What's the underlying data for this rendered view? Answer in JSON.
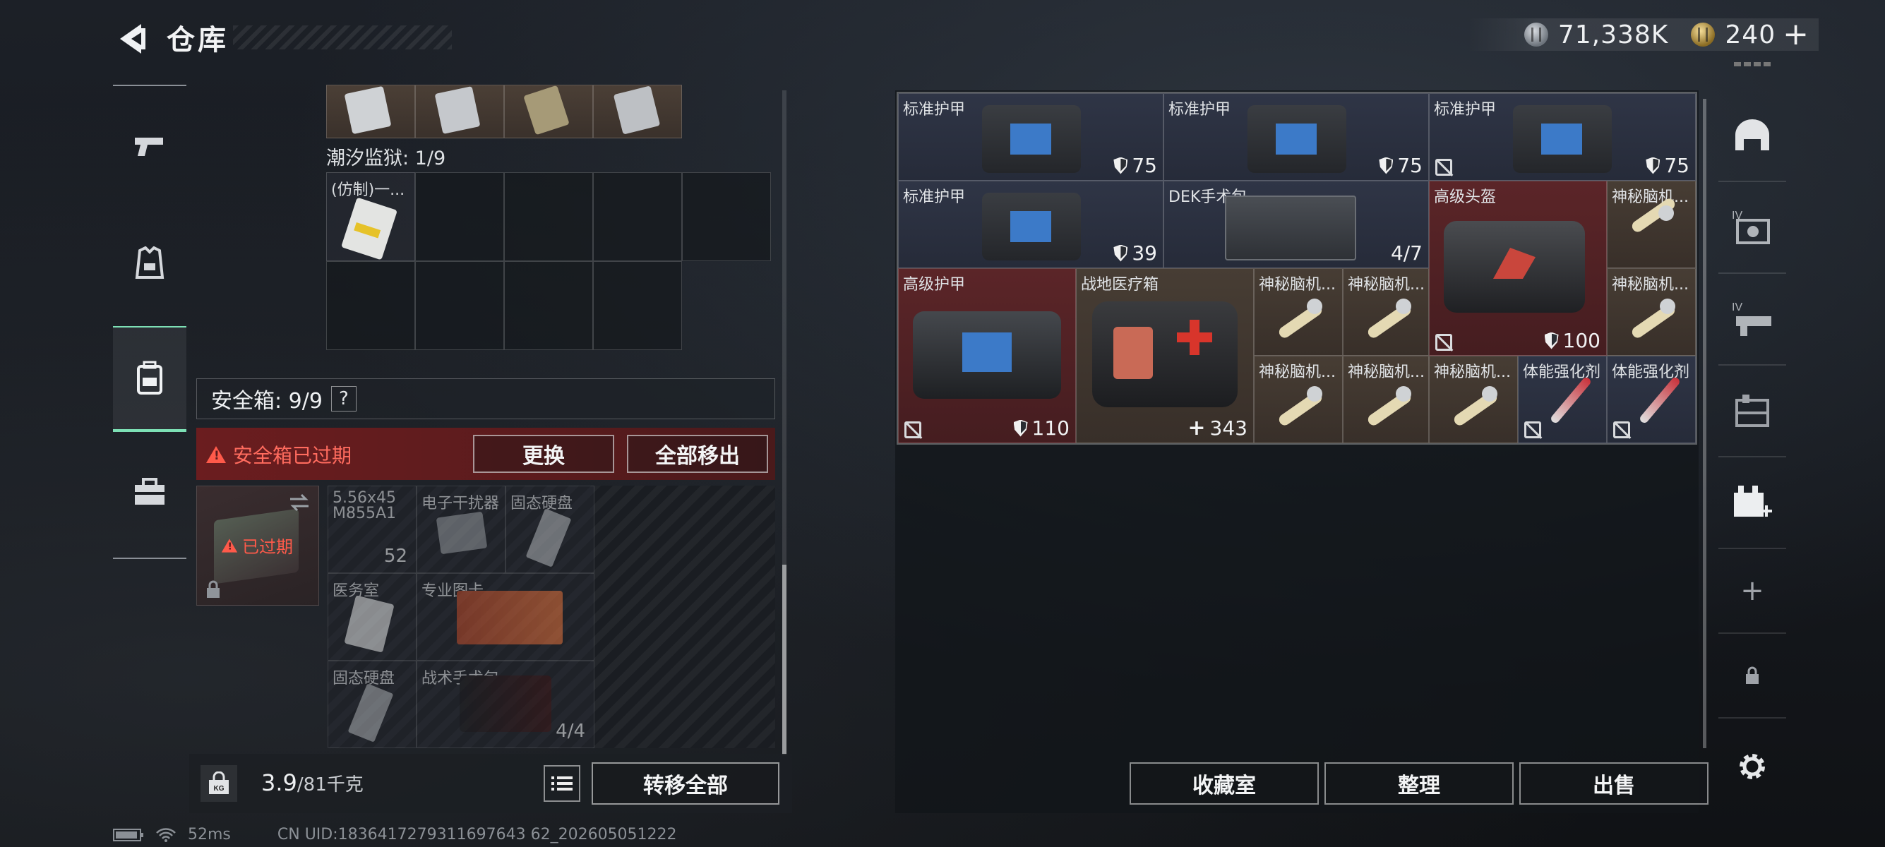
{
  "header": {
    "title": "仓库"
  },
  "currency": {
    "silver": "71,338K",
    "gold": "240",
    "add_symbol": "+"
  },
  "left_nav": [
    {
      "icon": "pistol-icon"
    },
    {
      "icon": "armor-vest-icon"
    },
    {
      "icon": "backpack-icon",
      "active": true
    },
    {
      "icon": "toolbox-icon"
    }
  ],
  "inventory": {
    "prison_label": "潮汐监狱: 1/9",
    "prison_item": "(仿制)一...",
    "safe_box": {
      "title": "安全箱: 9/9",
      "help": "?",
      "expired_msg": "安全箱已过期",
      "replace_label": "更换",
      "move_all_label": "全部移出",
      "thumb_status": "已过期",
      "items": [
        {
          "name": "5.56x45\nM855A1",
          "count": "52"
        },
        {
          "name": "电子干扰器",
          "count": ""
        },
        {
          "name": "固态硬盘",
          "count": ""
        },
        {
          "name": "医务室",
          "count": ""
        },
        {
          "name": "专业图卡",
          "count": ""
        },
        {
          "name": "固态硬盘",
          "count": ""
        },
        {
          "name": "战术手术包",
          "count": "4/4"
        }
      ]
    },
    "weight": {
      "value": "3.9",
      "capacity": "/81千克"
    },
    "kg_label": "KG",
    "transfer_all_label": "转移全部"
  },
  "warehouse": {
    "items": [
      {
        "name": "标准护甲",
        "value": "75",
        "badge": "shield",
        "color": "blue"
      },
      {
        "name": "标准护甲",
        "value": "75",
        "badge": "shield",
        "color": "blue"
      },
      {
        "name": "标准护甲",
        "value": "75",
        "badge": "shield",
        "color": "blue",
        "no_trade": true
      },
      {
        "name": "标准护甲",
        "value": "39",
        "badge": "shield",
        "color": "blue"
      },
      {
        "name": "DEK手术包",
        "value": "4/7",
        "color": "blue"
      },
      {
        "name": "高级头盔",
        "value": "100",
        "badge": "shield",
        "color": "red",
        "no_trade": true
      },
      {
        "name": "神秘脑机...",
        "color": "tan"
      },
      {
        "name": "高级护甲",
        "value": "110",
        "badge": "shield",
        "color": "red",
        "no_trade": true
      },
      {
        "name": "战地医疗箱",
        "value": "343",
        "badge": "plus",
        "color": "tan"
      },
      {
        "name": "神秘脑机...",
        "color": "tan"
      },
      {
        "name": "神秘脑机...",
        "color": "tan"
      },
      {
        "name": "神秘脑机...",
        "color": "tan"
      },
      {
        "name": "神秘脑机...",
        "color": "tan"
      },
      {
        "name": "神秘脑机...",
        "color": "tan"
      },
      {
        "name": "神秘脑机...",
        "color": "tan"
      },
      {
        "name": "体能强化剂",
        "color": "blue",
        "no_trade": true
      },
      {
        "name": "体能强化剂",
        "color": "blue",
        "no_trade": true
      }
    ],
    "buttons": {
      "collection": "收藏室",
      "organize": "整理",
      "sell": "出售"
    }
  },
  "right_nav": [
    {
      "icon": "helmet-icon"
    },
    {
      "icon": "tier-iv-vest-icon",
      "text": "IV"
    },
    {
      "icon": "tier-iv-rifle-icon",
      "text": "IV"
    },
    {
      "icon": "storage-icon"
    },
    {
      "icon": "add-storage-icon"
    },
    {
      "icon": "plus-icon",
      "text": "+"
    },
    {
      "icon": "lock-icon"
    }
  ],
  "status_bar": {
    "ping": "52ms",
    "uid": "CN UID:1836417279311697643 62_202605051222"
  },
  "colors": {
    "accent": "#7de0b5",
    "expired": "#ff5a4a",
    "expired_bg": "#6b1d1f"
  }
}
